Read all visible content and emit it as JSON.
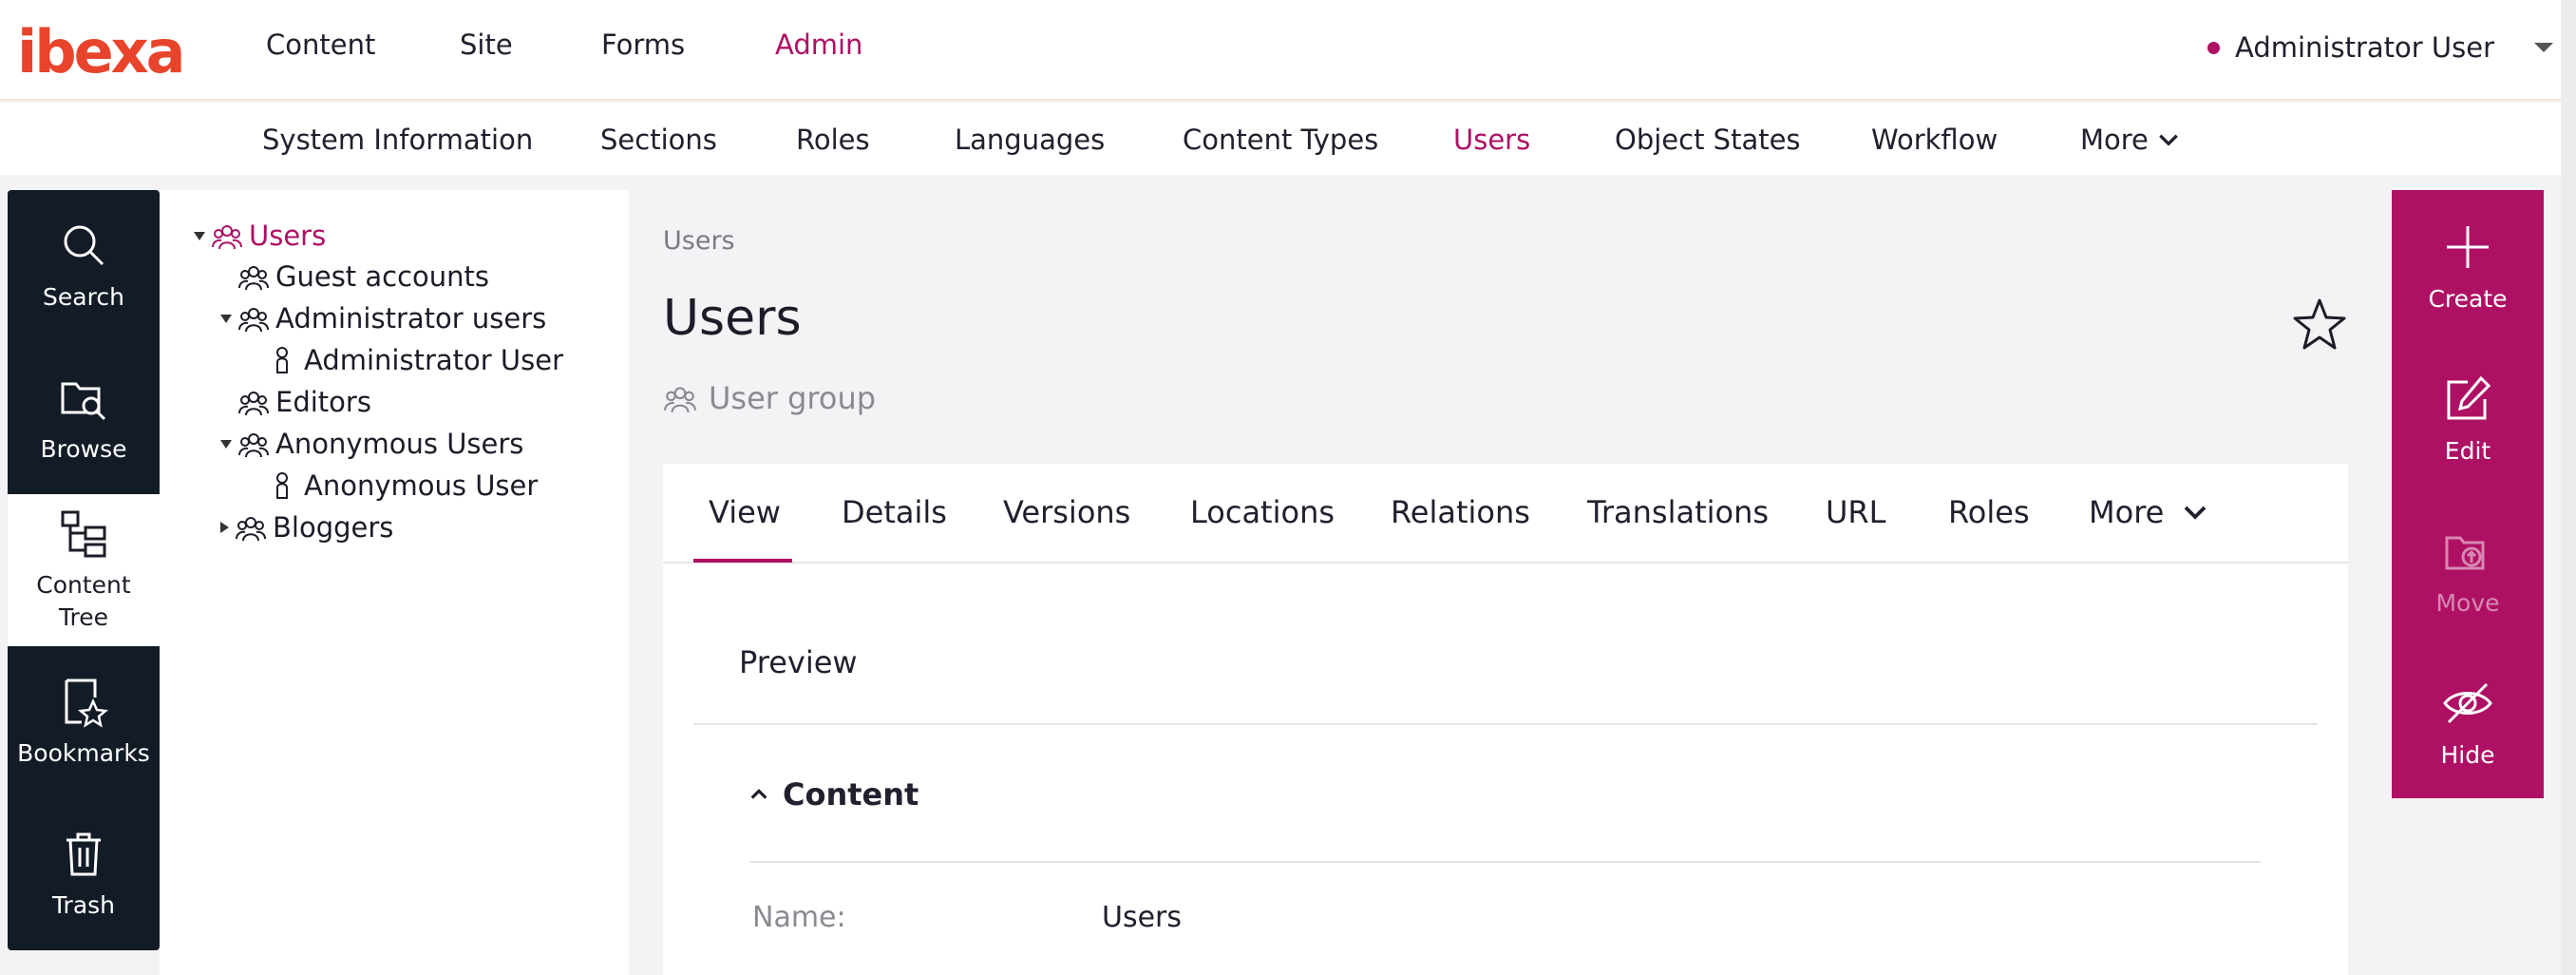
{
  "brand": {
    "logo_text": "ibexa",
    "accent": "#ae1164",
    "sidebar_dark": "#131c26"
  },
  "main_nav": [
    "Content",
    "Site",
    "Forms",
    "Admin"
  ],
  "main_nav_active": "Admin",
  "user_menu": {
    "name": "Administrator User"
  },
  "sub_nav": [
    "System Information",
    "Sections",
    "Roles",
    "Languages",
    "Content Types",
    "Users",
    "Object States",
    "Workflow"
  ],
  "sub_nav_more": "More",
  "sub_nav_active": "Users",
  "left_sidebar": [
    {
      "label": "Search",
      "icon": "search-icon"
    },
    {
      "label": "Browse",
      "icon": "browse-icon"
    },
    {
      "label1": "Content",
      "label2": "Tree",
      "icon": "content-tree-icon"
    },
    {
      "label": "Bookmarks",
      "icon": "bookmarks-icon"
    },
    {
      "label": "Trash",
      "icon": "trash-icon"
    }
  ],
  "tree": [
    {
      "label": "Users",
      "icon": "user-group-icon",
      "expanded": true,
      "active": true
    },
    {
      "label": "Guest accounts",
      "icon": "user-group-icon"
    },
    {
      "label": "Administrator users",
      "icon": "user-group-icon",
      "expanded": true
    },
    {
      "label": "Administrator User",
      "icon": "user-icon"
    },
    {
      "label": "Editors",
      "icon": "user-group-icon"
    },
    {
      "label": "Anonymous Users",
      "icon": "user-group-icon",
      "expanded": true
    },
    {
      "label": "Anonymous User",
      "icon": "user-icon"
    },
    {
      "label": "Bloggers",
      "icon": "user-group-icon",
      "expanded": false
    }
  ],
  "breadcrumb": "Users",
  "page_title": "Users",
  "content_type": "User group",
  "tabs": [
    "View",
    "Details",
    "Versions",
    "Locations",
    "Relations",
    "Translations",
    "URL",
    "Roles"
  ],
  "tabs_more": "More",
  "tabs_active": "View",
  "preview_label": "Preview",
  "content_section": "Content",
  "fields": [
    {
      "label": "Name:",
      "value": "Users"
    }
  ],
  "right_sidebar": [
    {
      "label": "Create",
      "icon": "plus-icon",
      "enabled": true
    },
    {
      "label": "Edit",
      "icon": "edit-icon",
      "enabled": true
    },
    {
      "label": "Move",
      "icon": "move-icon",
      "enabled": false
    },
    {
      "label": "Hide",
      "icon": "hide-icon",
      "enabled": true
    }
  ]
}
